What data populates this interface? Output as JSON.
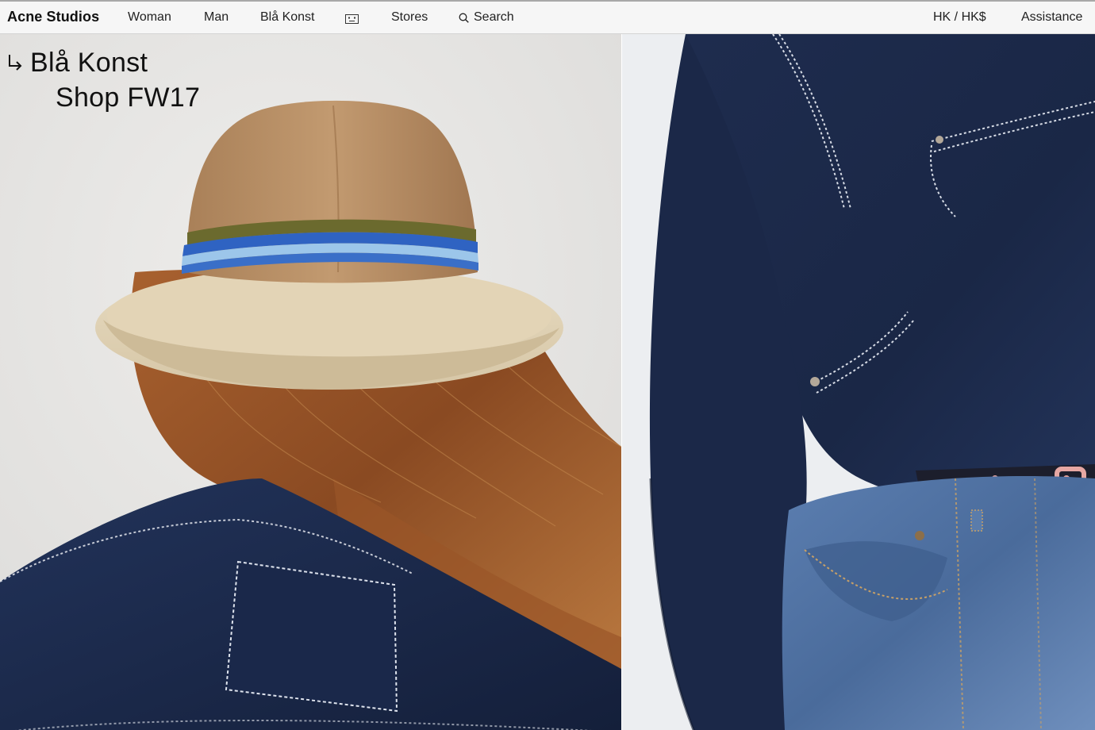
{
  "header": {
    "brand": "Acne Studios",
    "nav": {
      "woman": "Woman",
      "man": "Man",
      "bla_konst": "Blå Konst",
      "stores": "Stores",
      "search": "Search"
    },
    "region": "HK / HK$",
    "assistance": "Assistance",
    "icons": [
      "face-icon",
      "search-icon"
    ]
  },
  "hero": {
    "headline": {
      "line1": "Blå Konst",
      "line2": "Shop FW17",
      "icon": "arrow-down-right-icon"
    },
    "left_image": "woman-in-bucket-hat-back-view",
    "right_image": "navy-jacket-and-denim-jeans"
  },
  "colors": {
    "nav_bg": "#f6f6f6",
    "text": "#111111",
    "navy": "#1c2a4a",
    "denim": "#4a6b9b",
    "hat_tan": "#b48a62"
  }
}
